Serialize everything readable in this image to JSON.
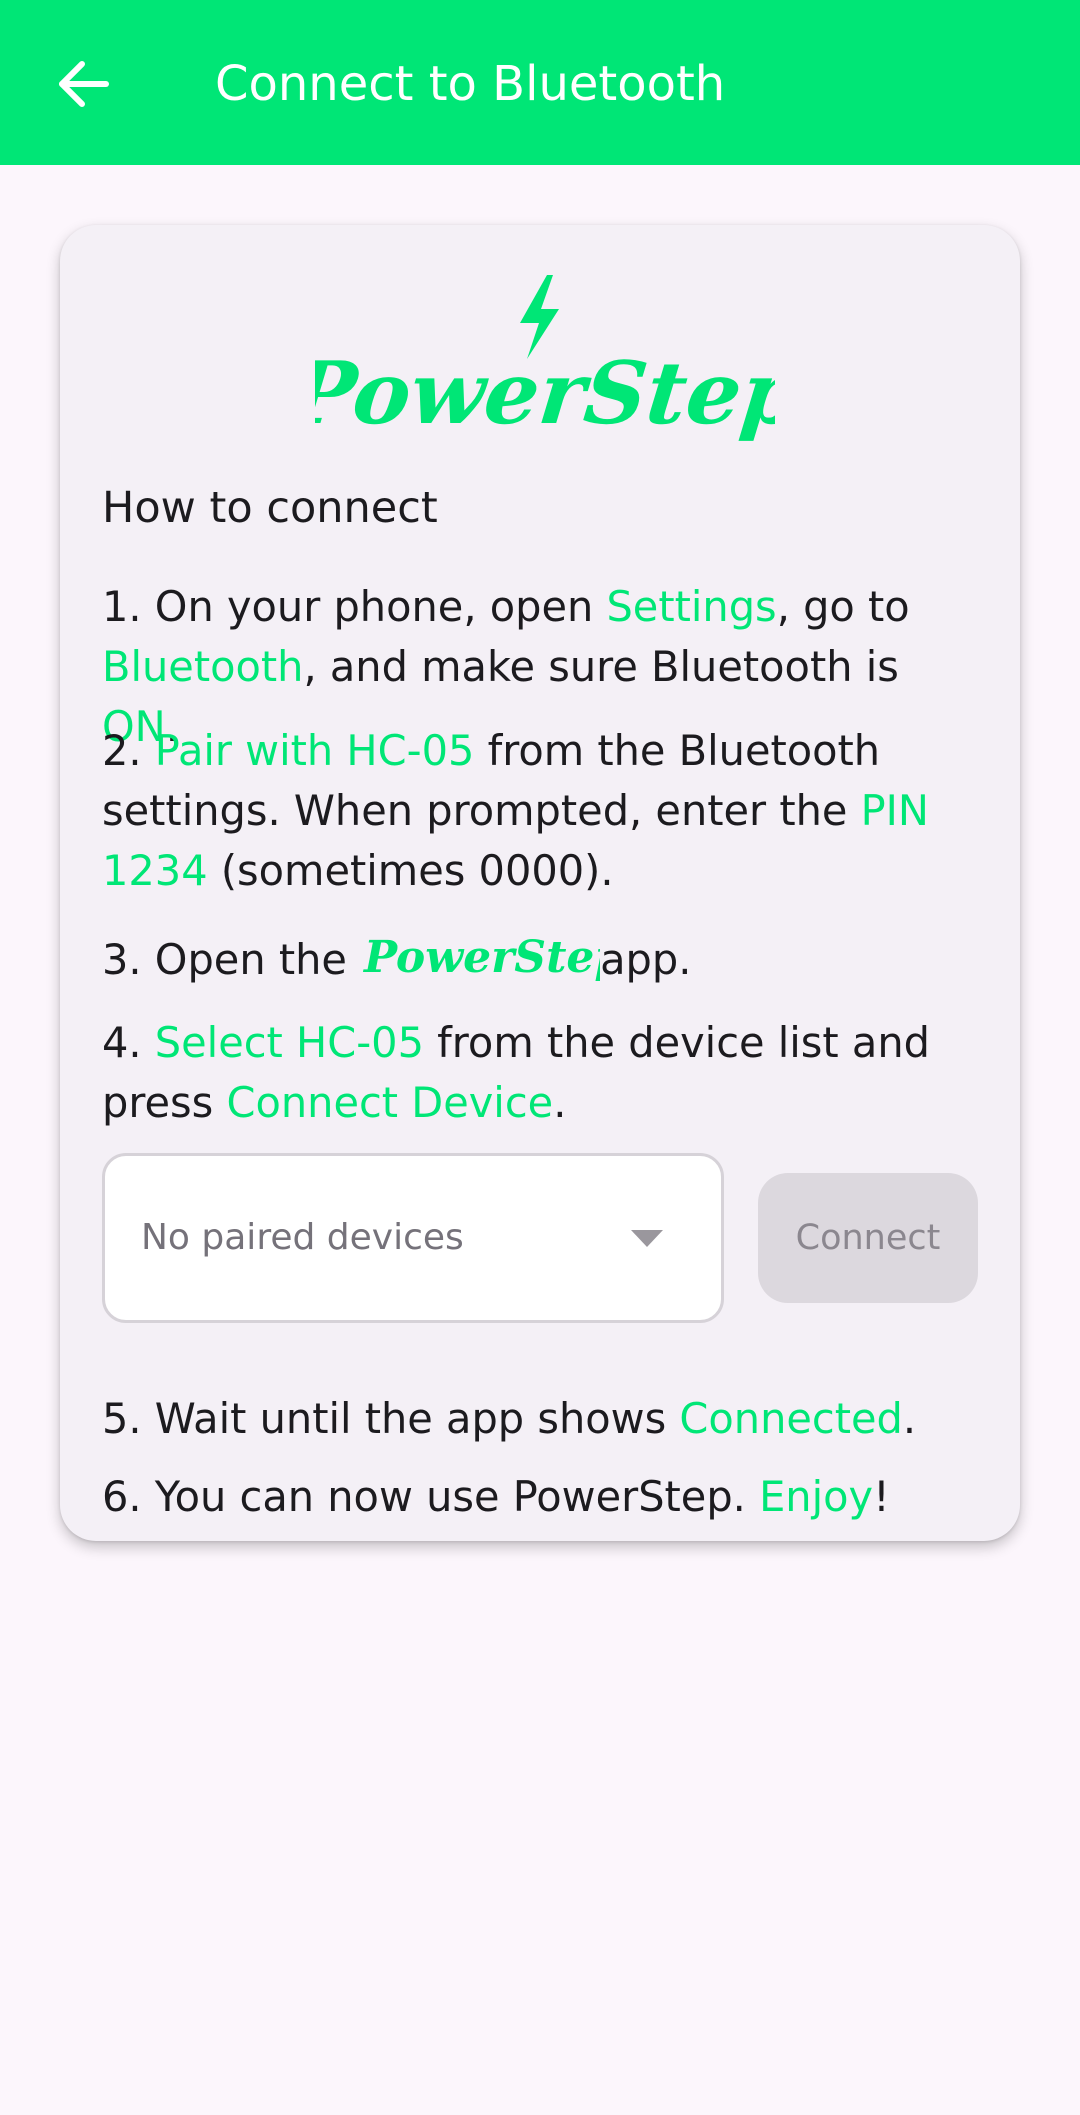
{
  "appbar": {
    "title": "Connect to Bluetooth",
    "back_icon": "arrow-left-icon",
    "background": "#00e676"
  },
  "brand": {
    "name": "PowerStep",
    "accent": "#00e676",
    "logo_icon": "lightning-bolt-icon"
  },
  "card": {
    "heading": "How to connect",
    "steps": [
      {
        "parts": [
          {
            "text": "1. On your phone, open ",
            "hl": false
          },
          {
            "text": "Settings",
            "hl": true
          },
          {
            "text": ", go to ",
            "hl": false
          },
          {
            "text": "Bluetooth",
            "hl": true
          },
          {
            "text": ", and make sure Bluetooth is ",
            "hl": false
          },
          {
            "text": "ON",
            "hl": true
          },
          {
            "text": ".",
            "hl": false
          }
        ]
      },
      {
        "parts": [
          {
            "text": "2. ",
            "hl": false
          },
          {
            "text": "Pair with HC-05",
            "hl": true
          },
          {
            "text": " from the Bluetooth settings. When prompted, enter the ",
            "hl": false
          },
          {
            "text": "PIN 1234",
            "hl": true
          },
          {
            "text": " (sometimes 0000).",
            "hl": false
          }
        ]
      },
      {
        "before": "3. Open the ",
        "after": "app."
      },
      {
        "parts": [
          {
            "text": "4. ",
            "hl": false
          },
          {
            "text": "Select HC-05",
            "hl": true
          },
          {
            "text": " from the device list and press ",
            "hl": false
          },
          {
            "text": "Connect Device",
            "hl": true
          },
          {
            "text": ".",
            "hl": false
          }
        ]
      },
      {
        "parts": [
          {
            "text": "5. Wait until the app shows ",
            "hl": false
          },
          {
            "text": "Connected",
            "hl": true
          },
          {
            "text": ".",
            "hl": false
          }
        ]
      },
      {
        "parts": [
          {
            "text": "6. You can now use PowerStep. ",
            "hl": false
          },
          {
            "text": "Enjoy",
            "hl": true
          },
          {
            "text": "!",
            "hl": false
          }
        ]
      }
    ],
    "device_select": {
      "value": "No paired devices",
      "caret_icon": "dropdown-caret-icon"
    },
    "connect_button": {
      "label": "Connect",
      "enabled": false
    }
  }
}
